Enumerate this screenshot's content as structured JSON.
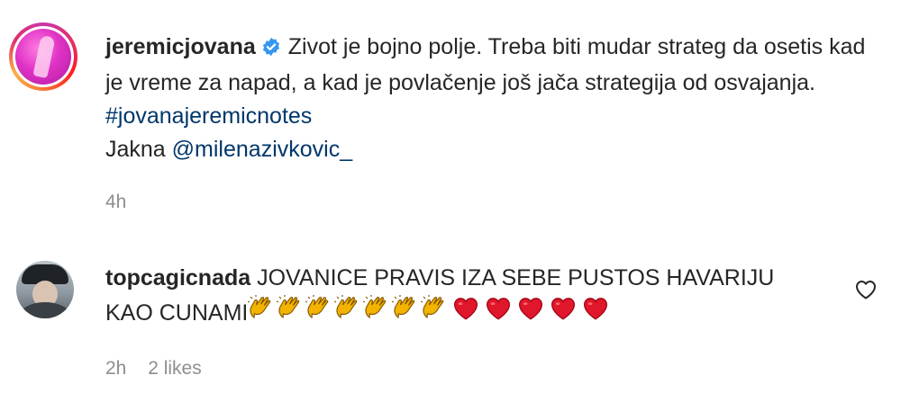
{
  "caption": {
    "username": "jeremicjovana",
    "text": "Zivot je bojno polje. Treba biti mudar strateg da osetis kad je vreme za napad, a kad je povlačenje još jača strategija od osvajanja.",
    "hashtag": "#jovanajeremicnotes",
    "jacket_label": "Jakna",
    "mention": "@milenazivkovic_",
    "time": "4h"
  },
  "comment": {
    "username": "topcagicnada",
    "text": "JOVANICE PRAVIS IZA SEBE PUSTOS HAVARIJU KAO CUNAMI",
    "emoji_claps": 7,
    "emoji_hearts": 5,
    "time": "2h",
    "likes": "2 likes"
  },
  "colors": {
    "link": "#00376b",
    "muted": "#8e8e8e",
    "verified": "#3897f0",
    "heart": "#e0162b"
  }
}
